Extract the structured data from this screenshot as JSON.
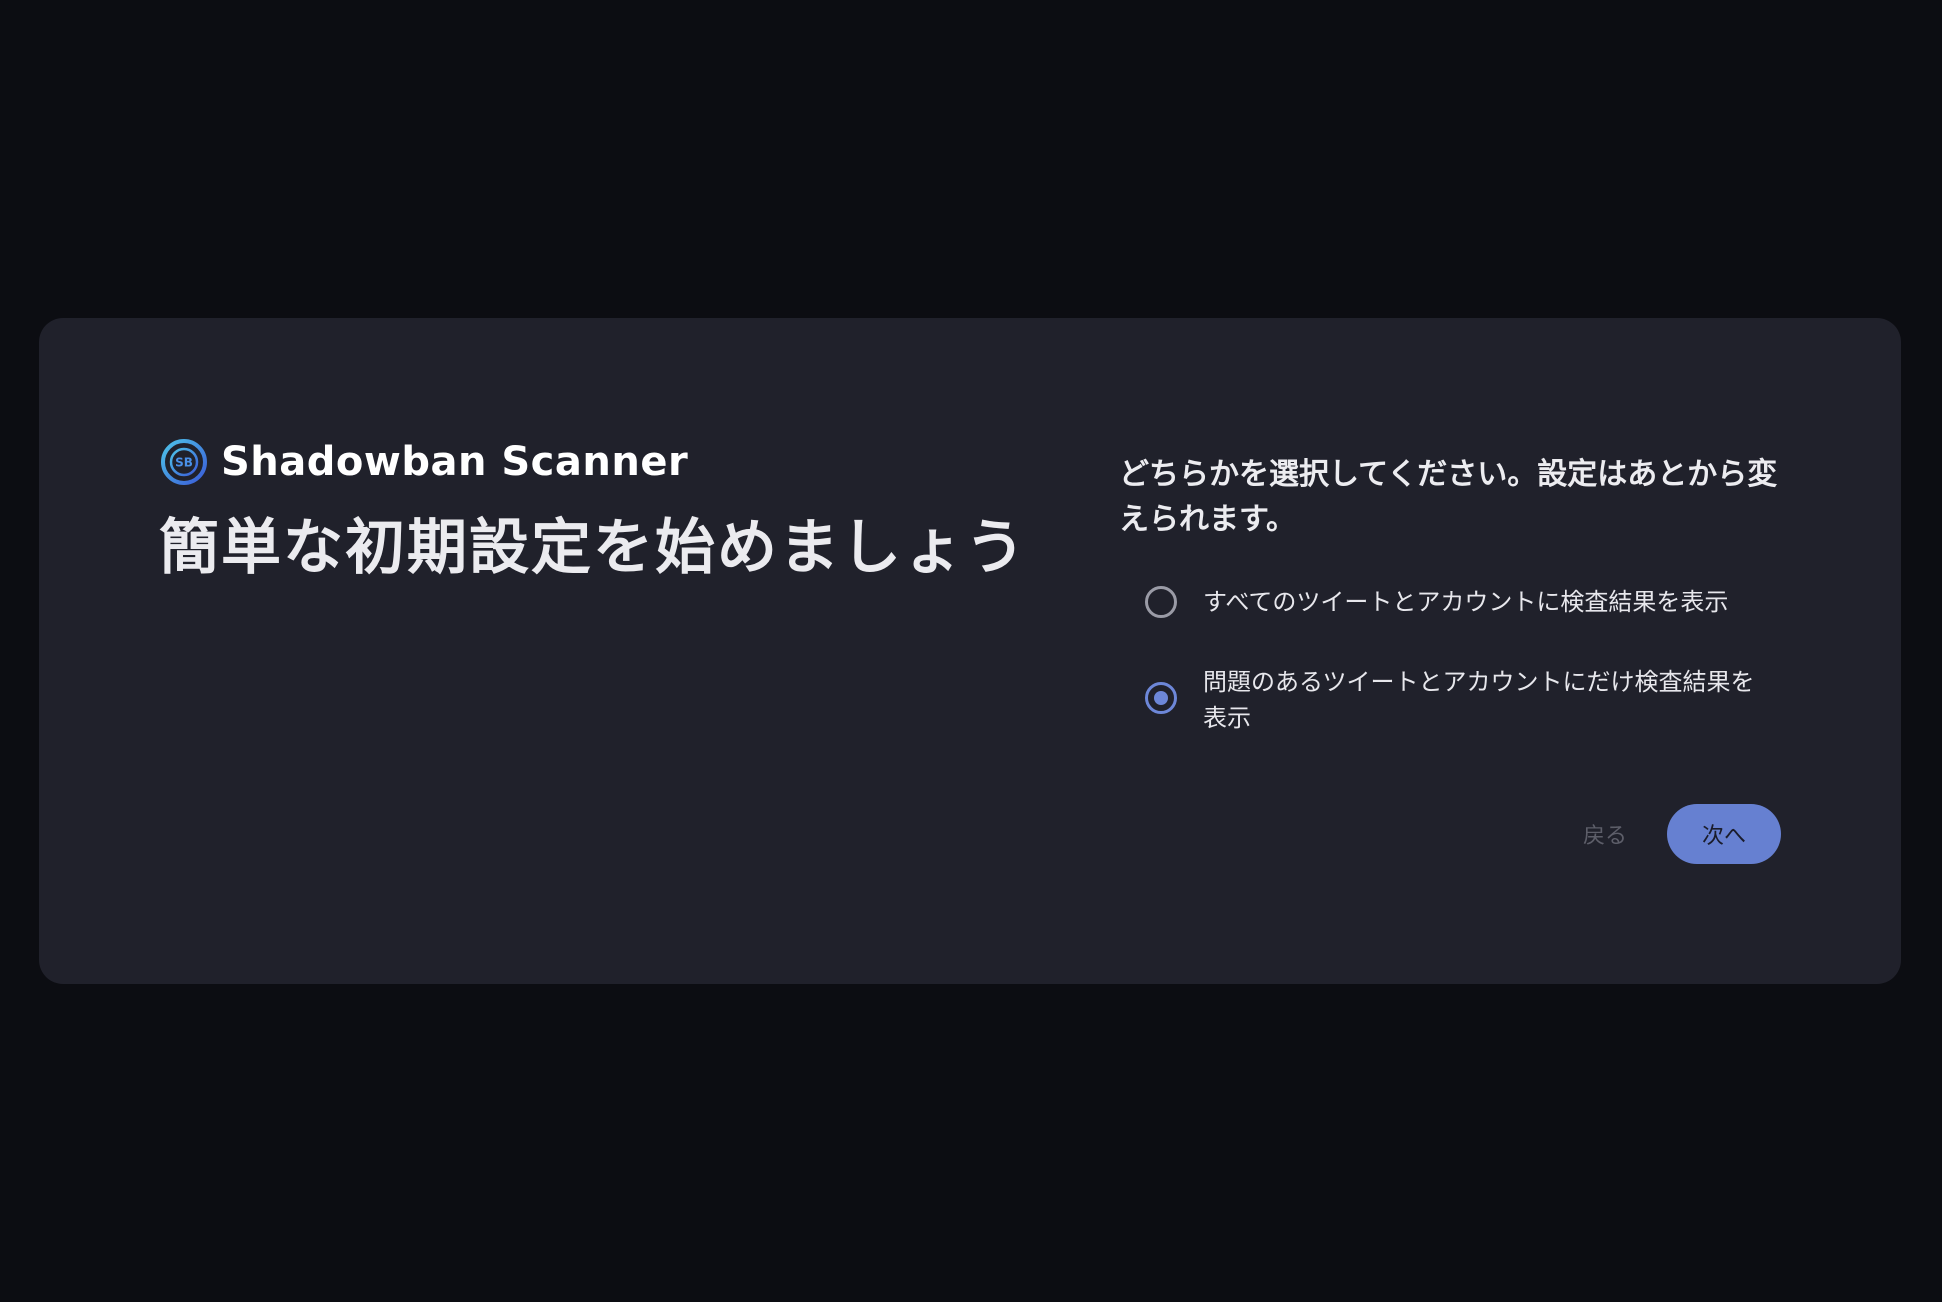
{
  "brand": {
    "name": "Shadowban Scanner",
    "icon": "sb-target-logo",
    "icon_text": "SB",
    "accent_color": "#4a7fe0"
  },
  "left": {
    "headline": "簡単な初期設定を始めましょう"
  },
  "setup": {
    "question": "どちらかを選択してください。設定はあとから変えられます。",
    "options": [
      {
        "label": "すべてのツイートとアカウントに検査結果を表示",
        "selected": false
      },
      {
        "label": "問題のあるツイートとアカウントにだけ検査結果を表示",
        "selected": true
      }
    ]
  },
  "buttons": {
    "back_label": "戻る",
    "next_label": "次へ"
  },
  "colors": {
    "page_background": "#0c0d12",
    "card_background": "#20212b",
    "primary": "#6680d1"
  }
}
